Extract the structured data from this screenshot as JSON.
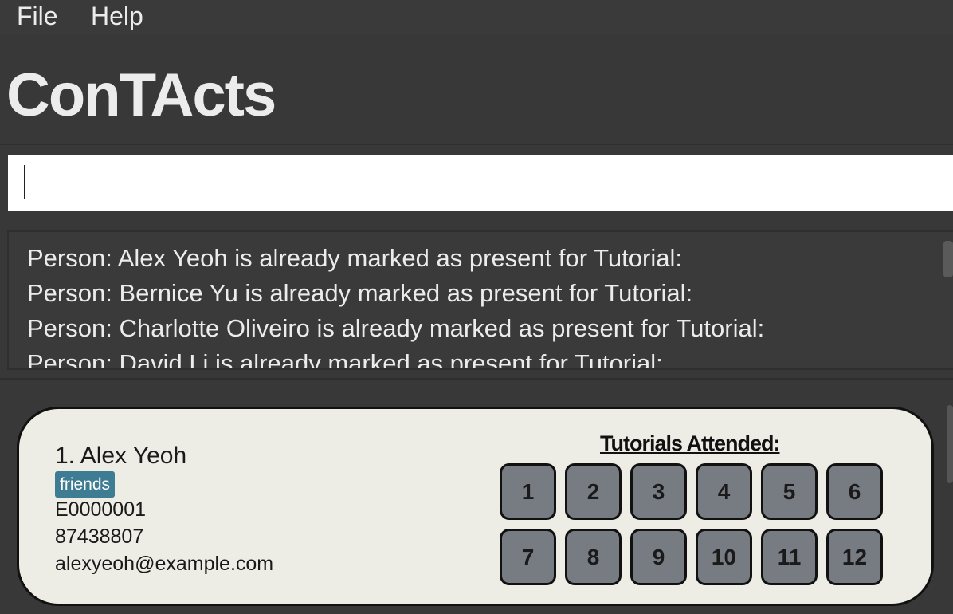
{
  "menu": {
    "file": "File",
    "help": "Help"
  },
  "app_title": "ConTActs",
  "command": {
    "value": "",
    "placeholder": ""
  },
  "results": [
    "Person: Alex Yeoh is already marked as present for Tutorial:",
    "Person: Bernice Yu is already marked as present for Tutorial:",
    "Person: Charlotte Oliveiro is already marked as present for Tutorial:",
    "Person: David Li is already marked as present for Tutorial:"
  ],
  "person": {
    "name": "1. Alex Yeoh",
    "tag": "friends",
    "student_id": "E0000001",
    "phone": "87438807",
    "email": "alexyeoh@example.com",
    "tutorials_title": "Tutorials Attended:",
    "tutorials": [
      "1",
      "2",
      "3",
      "4",
      "5",
      "6",
      "7",
      "8",
      "9",
      "10",
      "11",
      "12"
    ]
  },
  "colors": {
    "tag": "#3d7c92",
    "card": "#eeede5",
    "tutorial_box": "#777b82",
    "background": "#383838"
  }
}
